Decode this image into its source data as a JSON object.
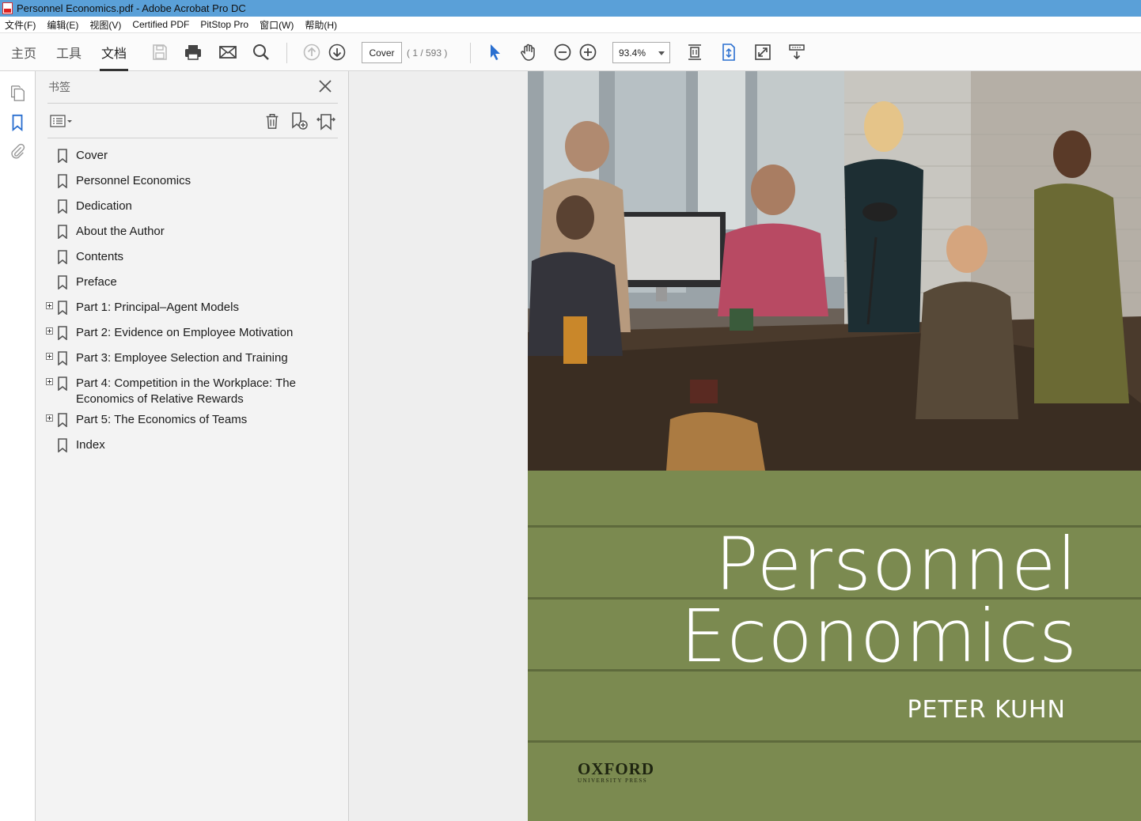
{
  "window": {
    "title": "Personnel Economics.pdf - Adobe Acrobat Pro DC"
  },
  "menu": [
    "文件(F)",
    "编辑(E)",
    "视图(V)",
    "Certified PDF",
    "PitStop Pro",
    "窗口(W)",
    "帮助(H)"
  ],
  "toolbar": {
    "tabs": [
      "主页",
      "工具",
      "文档"
    ],
    "active_tab": "文档",
    "page_label": "Cover",
    "page_count": "( 1 / 593 )",
    "zoom": "93.4%"
  },
  "bookmarks_panel": {
    "title": "书签",
    "items": [
      {
        "label": "Cover",
        "expandable": false
      },
      {
        "label": "Personnel Economics",
        "expandable": false
      },
      {
        "label": "Dedication",
        "expandable": false
      },
      {
        "label": "About the Author",
        "expandable": false
      },
      {
        "label": "Contents",
        "expandable": false
      },
      {
        "label": "Preface",
        "expandable": false
      },
      {
        "label": "Part 1: Principal–Agent Models",
        "expandable": true
      },
      {
        "label": "Part 2: Evidence on Employee Motivation",
        "expandable": true
      },
      {
        "label": "Part 3: Employee Selection and Training",
        "expandable": true
      },
      {
        "label": "Part 4: Competition in the Workplace: The Economics of Relative Rewards",
        "expandable": true
      },
      {
        "label": "Part 5: The Economics of Teams",
        "expandable": true
      },
      {
        "label": "Index",
        "expandable": false
      }
    ]
  },
  "document": {
    "cover_title_line1": "Personnel",
    "cover_title_line2": "Economics",
    "author": "PETER KUHN",
    "publisher": "OXFORD",
    "publisher_sub": "UNIVERSITY PRESS",
    "cover_color": "#7b8a50"
  }
}
